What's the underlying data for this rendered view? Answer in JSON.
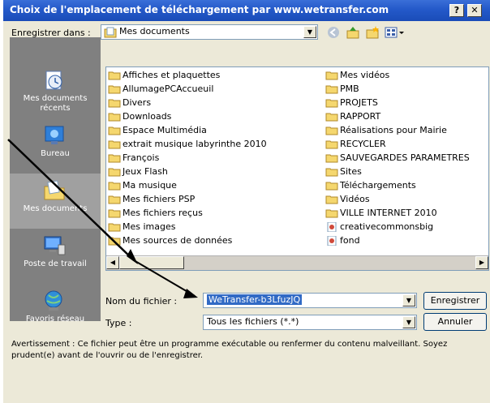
{
  "window": {
    "title": "Choix de l'emplacement de téléchargement par www.wetransfer.com",
    "help_label": "?",
    "close_label": "✕"
  },
  "lookin": {
    "label": "Enregistrer dans :",
    "value": "Mes documents"
  },
  "places": [
    {
      "label": "Mes documents récents",
      "icon": "recent-documents-icon"
    },
    {
      "label": "Bureau",
      "icon": "desktop-icon"
    },
    {
      "label": "Mes documents",
      "icon": "my-documents-icon"
    },
    {
      "label": "Poste de travail",
      "icon": "my-computer-icon"
    },
    {
      "label": "Favoris réseau",
      "icon": "network-places-icon"
    }
  ],
  "files_col1": [
    "Affiches et plaquettes",
    "AllumagePCAccueuil",
    "Divers",
    "Downloads",
    "Espace Multimédia",
    "extrait musique labyrinthe 2010",
    "François",
    "Jeux Flash",
    "Ma musique",
    "Mes fichiers PSP",
    "Mes fichiers reçus",
    "Mes images",
    "Mes sources de données"
  ],
  "files_col2": [
    "Mes vidéos",
    "PMB",
    "PROJETS",
    "RAPPORT",
    "Réalisations pour Mairie",
    "RECYCLER",
    "SAUVEGARDES PARAMETRES",
    "Sites",
    "Téléchargements",
    "Vidéos",
    "VILLE INTERNET 2010",
    "creativecommonsbig",
    "fond"
  ],
  "filename": {
    "label": "Nom du fichier :",
    "value": "WeTransfer-b3LfuzJQ"
  },
  "filetype": {
    "label": "Type :",
    "value": "Tous les fichiers (*.*)"
  },
  "buttons": {
    "save": "Enregistrer",
    "cancel": "Annuler"
  },
  "warning": "Avertissement : Ce fichier peut être un programme exécutable ou renfermer du contenu malveillant. Soyez prudent(e) avant de l'ouvrir ou de l'enregistrer.",
  "colors": {
    "titlebar": "#2459c9",
    "dialog": "#ece9d8",
    "selection": "#316ac5",
    "folder": "#f5d76e"
  }
}
